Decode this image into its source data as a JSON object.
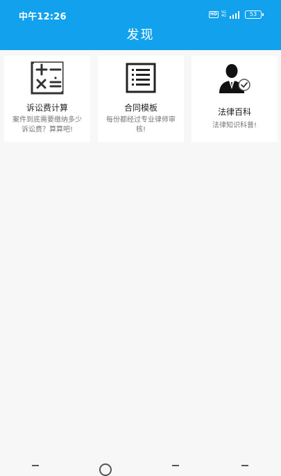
{
  "status_bar": {
    "time": "中午12:26",
    "hd": "HD",
    "net_top": "5G",
    "net_bottom": "4G",
    "battery": "53"
  },
  "header": {
    "title": "发现",
    "color": "#12a1ec"
  },
  "cards": [
    {
      "title": "诉讼费计算",
      "desc": "案件到底需要缴纳多少诉讼费？算算吧!",
      "icon": "calculator-icon"
    },
    {
      "title": "合同模板",
      "desc": "每份都经过专业律师审核!",
      "icon": "document-list-icon"
    },
    {
      "title": "法律百科",
      "desc": "法律知识科普!",
      "icon": "lawyer-icon"
    }
  ]
}
